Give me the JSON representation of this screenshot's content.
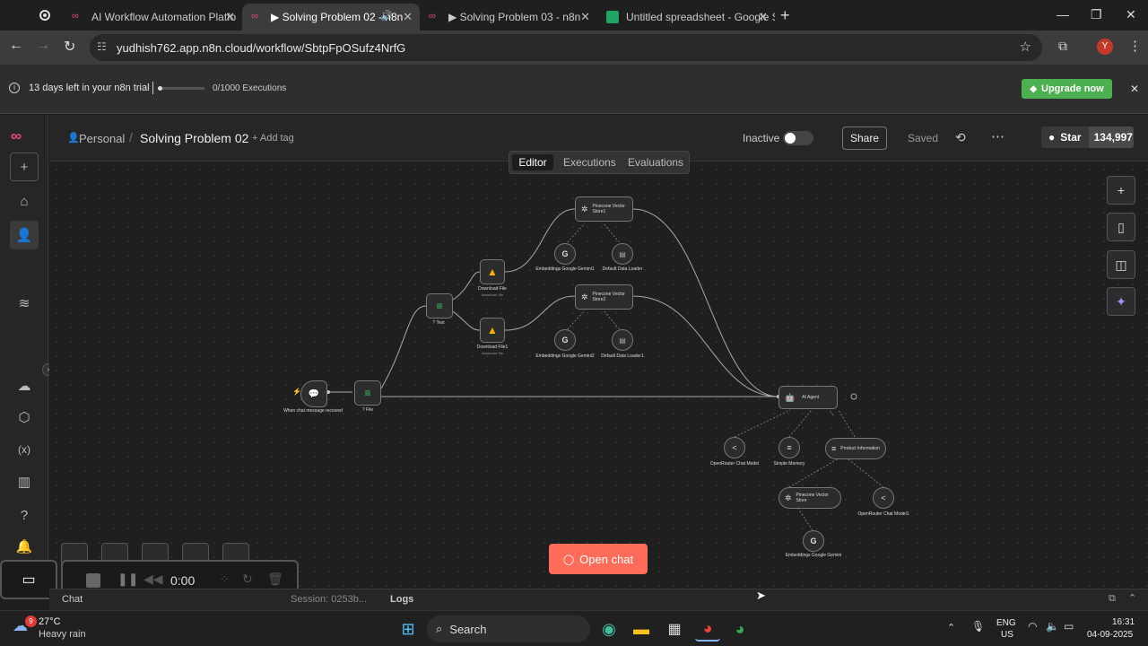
{
  "tabs": [
    {
      "title": "AI Workflow Automation Platfo",
      "active": false
    },
    {
      "title": "▶ Solving Problem 02 - n8n",
      "active": true
    },
    {
      "title": "▶ Solving Problem 03 - n8n",
      "active": false
    },
    {
      "title": "Untitled spreadsheet - Google S",
      "active": false
    }
  ],
  "address": {
    "url": "yudhish762.app.n8n.cloud/workflow/SbtpFpOSufz4NrfG"
  },
  "profile_initial": "Y",
  "trial": {
    "text": "13 days left in your n8n trial",
    "executions": "0/1000 Executions",
    "upgrade": "Upgrade now",
    "progress": 0.0
  },
  "header": {
    "workspace": "Personal",
    "title": "Solving Problem 02",
    "add_tag": "+ Add tag",
    "status": "Inactive",
    "share": "Share",
    "saved": "Saved",
    "star": "Star",
    "star_count": "134,997"
  },
  "view_tabs": [
    "Editor",
    "Executions",
    "Evaluations"
  ],
  "nodes": {
    "trigger": {
      "label": "When chat message received"
    },
    "if_file": {
      "label": "? File"
    },
    "if_text": {
      "label": "? Text"
    },
    "download1": {
      "label": "Download File",
      "sub": "download: file"
    },
    "download2": {
      "label": "Download File1",
      "sub": "download: file"
    },
    "pinecone1": {
      "label": "Pinecone Vector Store1"
    },
    "pinecone2": {
      "label": "Pinecone Vector Store2"
    },
    "emb1": {
      "label": "Embeddings Google Gemini1"
    },
    "emb2": {
      "label": "Embeddings Google Gemini2"
    },
    "loader1": {
      "label": "Default Data Loader"
    },
    "loader2": {
      "label": "Default Data Loader1"
    },
    "agent": {
      "label": "AI Agent"
    },
    "openrouter": {
      "label": "OpenRouter Chat Model"
    },
    "memory": {
      "label": "Simple Memory"
    },
    "product": {
      "label": "Product Information"
    },
    "pinecone3": {
      "label": "Pinecone Vector Store"
    },
    "openrouter1": {
      "label": "OpenRouter Chat Model1"
    },
    "emb3": {
      "label": "Embeddings Google Gemini"
    }
  },
  "open_chat": "Open chat",
  "recorder": {
    "time": "0:00"
  },
  "bottom": {
    "chat": "Chat",
    "session": "Session: 0253b...",
    "logs": "Logs"
  },
  "taskbar": {
    "temp": "27°C",
    "weather": "Heavy rain",
    "badge": "9",
    "search": "Search",
    "lang1": "ENG",
    "lang2": "US",
    "time": "16:31",
    "date": "04-09-2025"
  }
}
